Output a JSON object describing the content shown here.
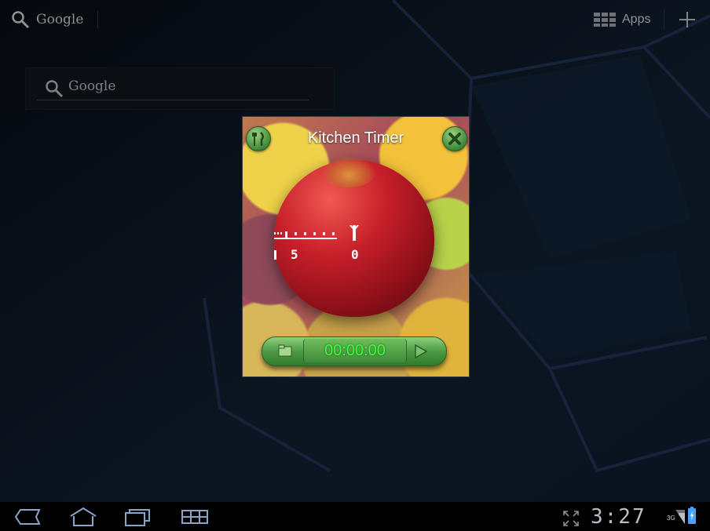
{
  "topbar": {
    "search_label": "Google",
    "apps_label": "Apps"
  },
  "google_widget": {
    "label": "Google"
  },
  "timer_widget": {
    "title": "Kitchen Timer",
    "dial": {
      "label_5": "5",
      "label_0": "0"
    },
    "time": "00:00:00"
  },
  "statusbar": {
    "clock": "3:27",
    "network": "3G"
  },
  "colors": {
    "timer_digits": "#3cff3c",
    "button_green": "#4c9a44"
  },
  "icons": {
    "back": "back-icon",
    "home": "home-icon",
    "recent": "recent-apps-icon",
    "menu": "menu-icon",
    "fullscreen": "fullscreen-icon",
    "signal": "signal-icon",
    "battery": "battery-icon"
  }
}
